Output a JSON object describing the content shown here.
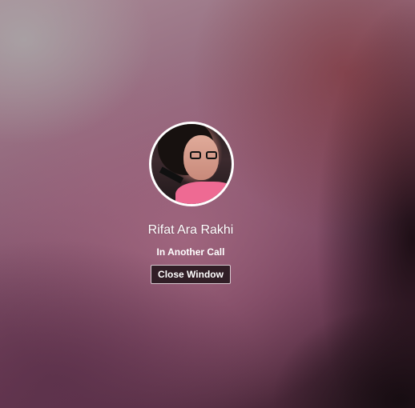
{
  "contact": {
    "name": "Rifat Ara Rakhi",
    "avatar_icon": "profile-photo"
  },
  "call": {
    "status": "In Another Call"
  },
  "actions": {
    "close_label": "Close Window"
  },
  "colors": {
    "text": "#ffffff",
    "button_bg": "#281920",
    "button_border": "#d8c8d0",
    "avatar_ring": "#ffffff"
  }
}
